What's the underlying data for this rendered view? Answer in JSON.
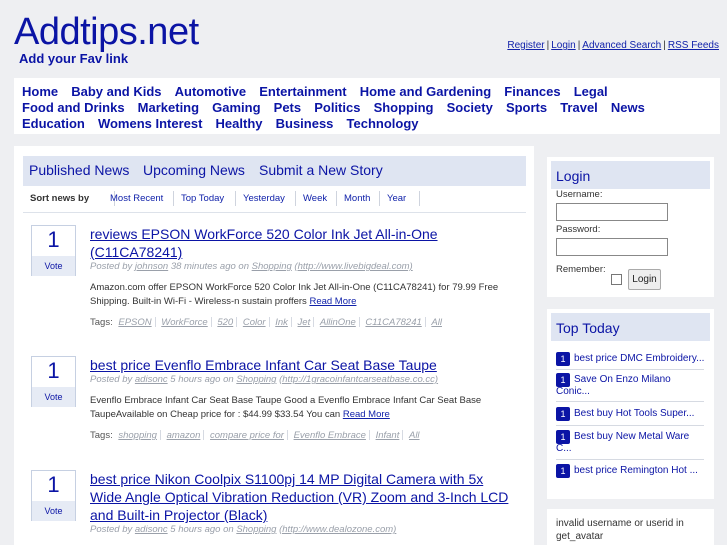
{
  "header": {
    "site_title": "Addtips.net",
    "tagline": "Add your Fav link",
    "links": [
      "Register",
      "Login",
      "Advanced Search",
      "RSS Feeds"
    ],
    "separator": "|"
  },
  "categories": [
    "Home",
    "Baby and Kids",
    "Automotive",
    "Entertainment",
    "Home and Gardening",
    "Finances",
    "Legal",
    "Food and Drinks",
    "Marketing",
    "Gaming",
    "Pets",
    "Politics",
    "Shopping",
    "Society",
    "Sports",
    "Travel",
    "News",
    "Education",
    "Womens Interest",
    "Healthy",
    "Business",
    "Technology"
  ],
  "main_tabs": [
    "Published News",
    "Upcoming News",
    "Submit a New Story"
  ],
  "sort": {
    "label": "Sort news by",
    "options": [
      "Most Recent",
      "Top Today",
      "Yesterday",
      "Week",
      "Month",
      "Year"
    ]
  },
  "stories": [
    {
      "votes": "1",
      "vote_label": "Vote",
      "title": "reviews EPSON WorkForce 520 Color Ink Jet All-in-One (C11CA78241)",
      "posted_by": "Posted by",
      "user": "johnson",
      "time": "38 minutes ago on",
      "category": "Shopping",
      "url": "(http://www.livebigdeal.com)",
      "excerpt": "Amazon.com offer EPSON WorkForce 520 Color Ink Jet All-in-One (C11CA78241) for 79.99 Free Shipping. Built-in Wi-Fi - Wireless-n sustain proffers",
      "read_more": "Read More",
      "tags_label": "Tags:",
      "tags": [
        "EPSON",
        "WorkForce",
        "520",
        "Color",
        "Ink",
        "Jet",
        "AllinOne",
        "C11CA78241",
        "All"
      ]
    },
    {
      "votes": "1",
      "vote_label": "Vote",
      "title": "best price Evenflo Embrace Infant Car Seat Base Taupe",
      "posted_by": "Posted by",
      "user": "adisonc",
      "time": "5 hours ago on",
      "category": "Shopping",
      "url": "(http://1gracoinfantcarseatbase.co.cc)",
      "excerpt": "Evenflo Embrace Infant Car Seat Base Taupe Good a Evenflo Embrace Infant Car Seat Base TaupeAvailable on Cheap price for : $44.99 $33.54 You can",
      "read_more": "Read More",
      "tags_label": "Tags:",
      "tags": [
        "shopping",
        "amazon",
        "compare price for",
        "Evenflo Embrace",
        "Infant",
        "All"
      ]
    },
    {
      "votes": "1",
      "vote_label": "Vote",
      "title": "best price Nikon Coolpix S1100pj 14 MP Digital Camera with 5x Wide Angle Optical Vibration Reduction (VR) Zoom and 3-Inch LCD and Built-in Projector (Black)",
      "posted_by": "Posted by",
      "user": "adisonc",
      "time": "5 hours ago on",
      "category": "Shopping",
      "url": "(http://www.dealozone.com)"
    }
  ],
  "login": {
    "title": "Login",
    "username_label": "Username:",
    "password_label": "Password:",
    "remember_label": "Remember:",
    "button": "Login"
  },
  "top_today": {
    "title": "Top Today",
    "items": [
      {
        "rank": "1",
        "title": "best price DMC Embroidery..."
      },
      {
        "rank": "1",
        "title": "Save On Enzo Milano Conic..."
      },
      {
        "rank": "1",
        "title": "Best buy Hot Tools Super..."
      },
      {
        "rank": "1",
        "title": "Best buy New Metal Ware C..."
      },
      {
        "rank": "1",
        "title": "best price Remington Hot ..."
      }
    ]
  },
  "side_message": "invalid username or userid in get_avatar",
  "colors": {
    "brand": "#0b14a5",
    "tab_bg": "#dfe5f2",
    "page_bg": "#eeeff2"
  }
}
